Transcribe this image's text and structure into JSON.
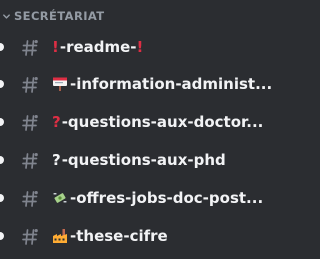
{
  "category": {
    "label": "SECRÉTARIAT",
    "icon": "chevron-down-icon"
  },
  "channels": [
    {
      "prefix": "!",
      "name": "-readme-",
      "suffix": "!",
      "emoji": "red-exclamation",
      "unread": true
    },
    {
      "name": "-information-administ...",
      "emoji": "memo-board",
      "unread": true
    },
    {
      "name": "-questions-aux-doctor...",
      "emoji": "red-question",
      "unread": true
    },
    {
      "name": "-questions-aux-phd",
      "emoji": "white-question",
      "unread": true
    },
    {
      "name": "-offres-jobs-doc-post...",
      "emoji": "money-wings",
      "unread": true
    },
    {
      "name": "-these-cifre",
      "emoji": "factory",
      "unread": true
    }
  ],
  "colors": {
    "background": "#2b2d31",
    "category_text": "#949ba4",
    "channel_text": "#f2f3f5",
    "hash": "#80848e",
    "unread_pill": "#f2f3f5",
    "accent_red": "#dd2e44"
  }
}
